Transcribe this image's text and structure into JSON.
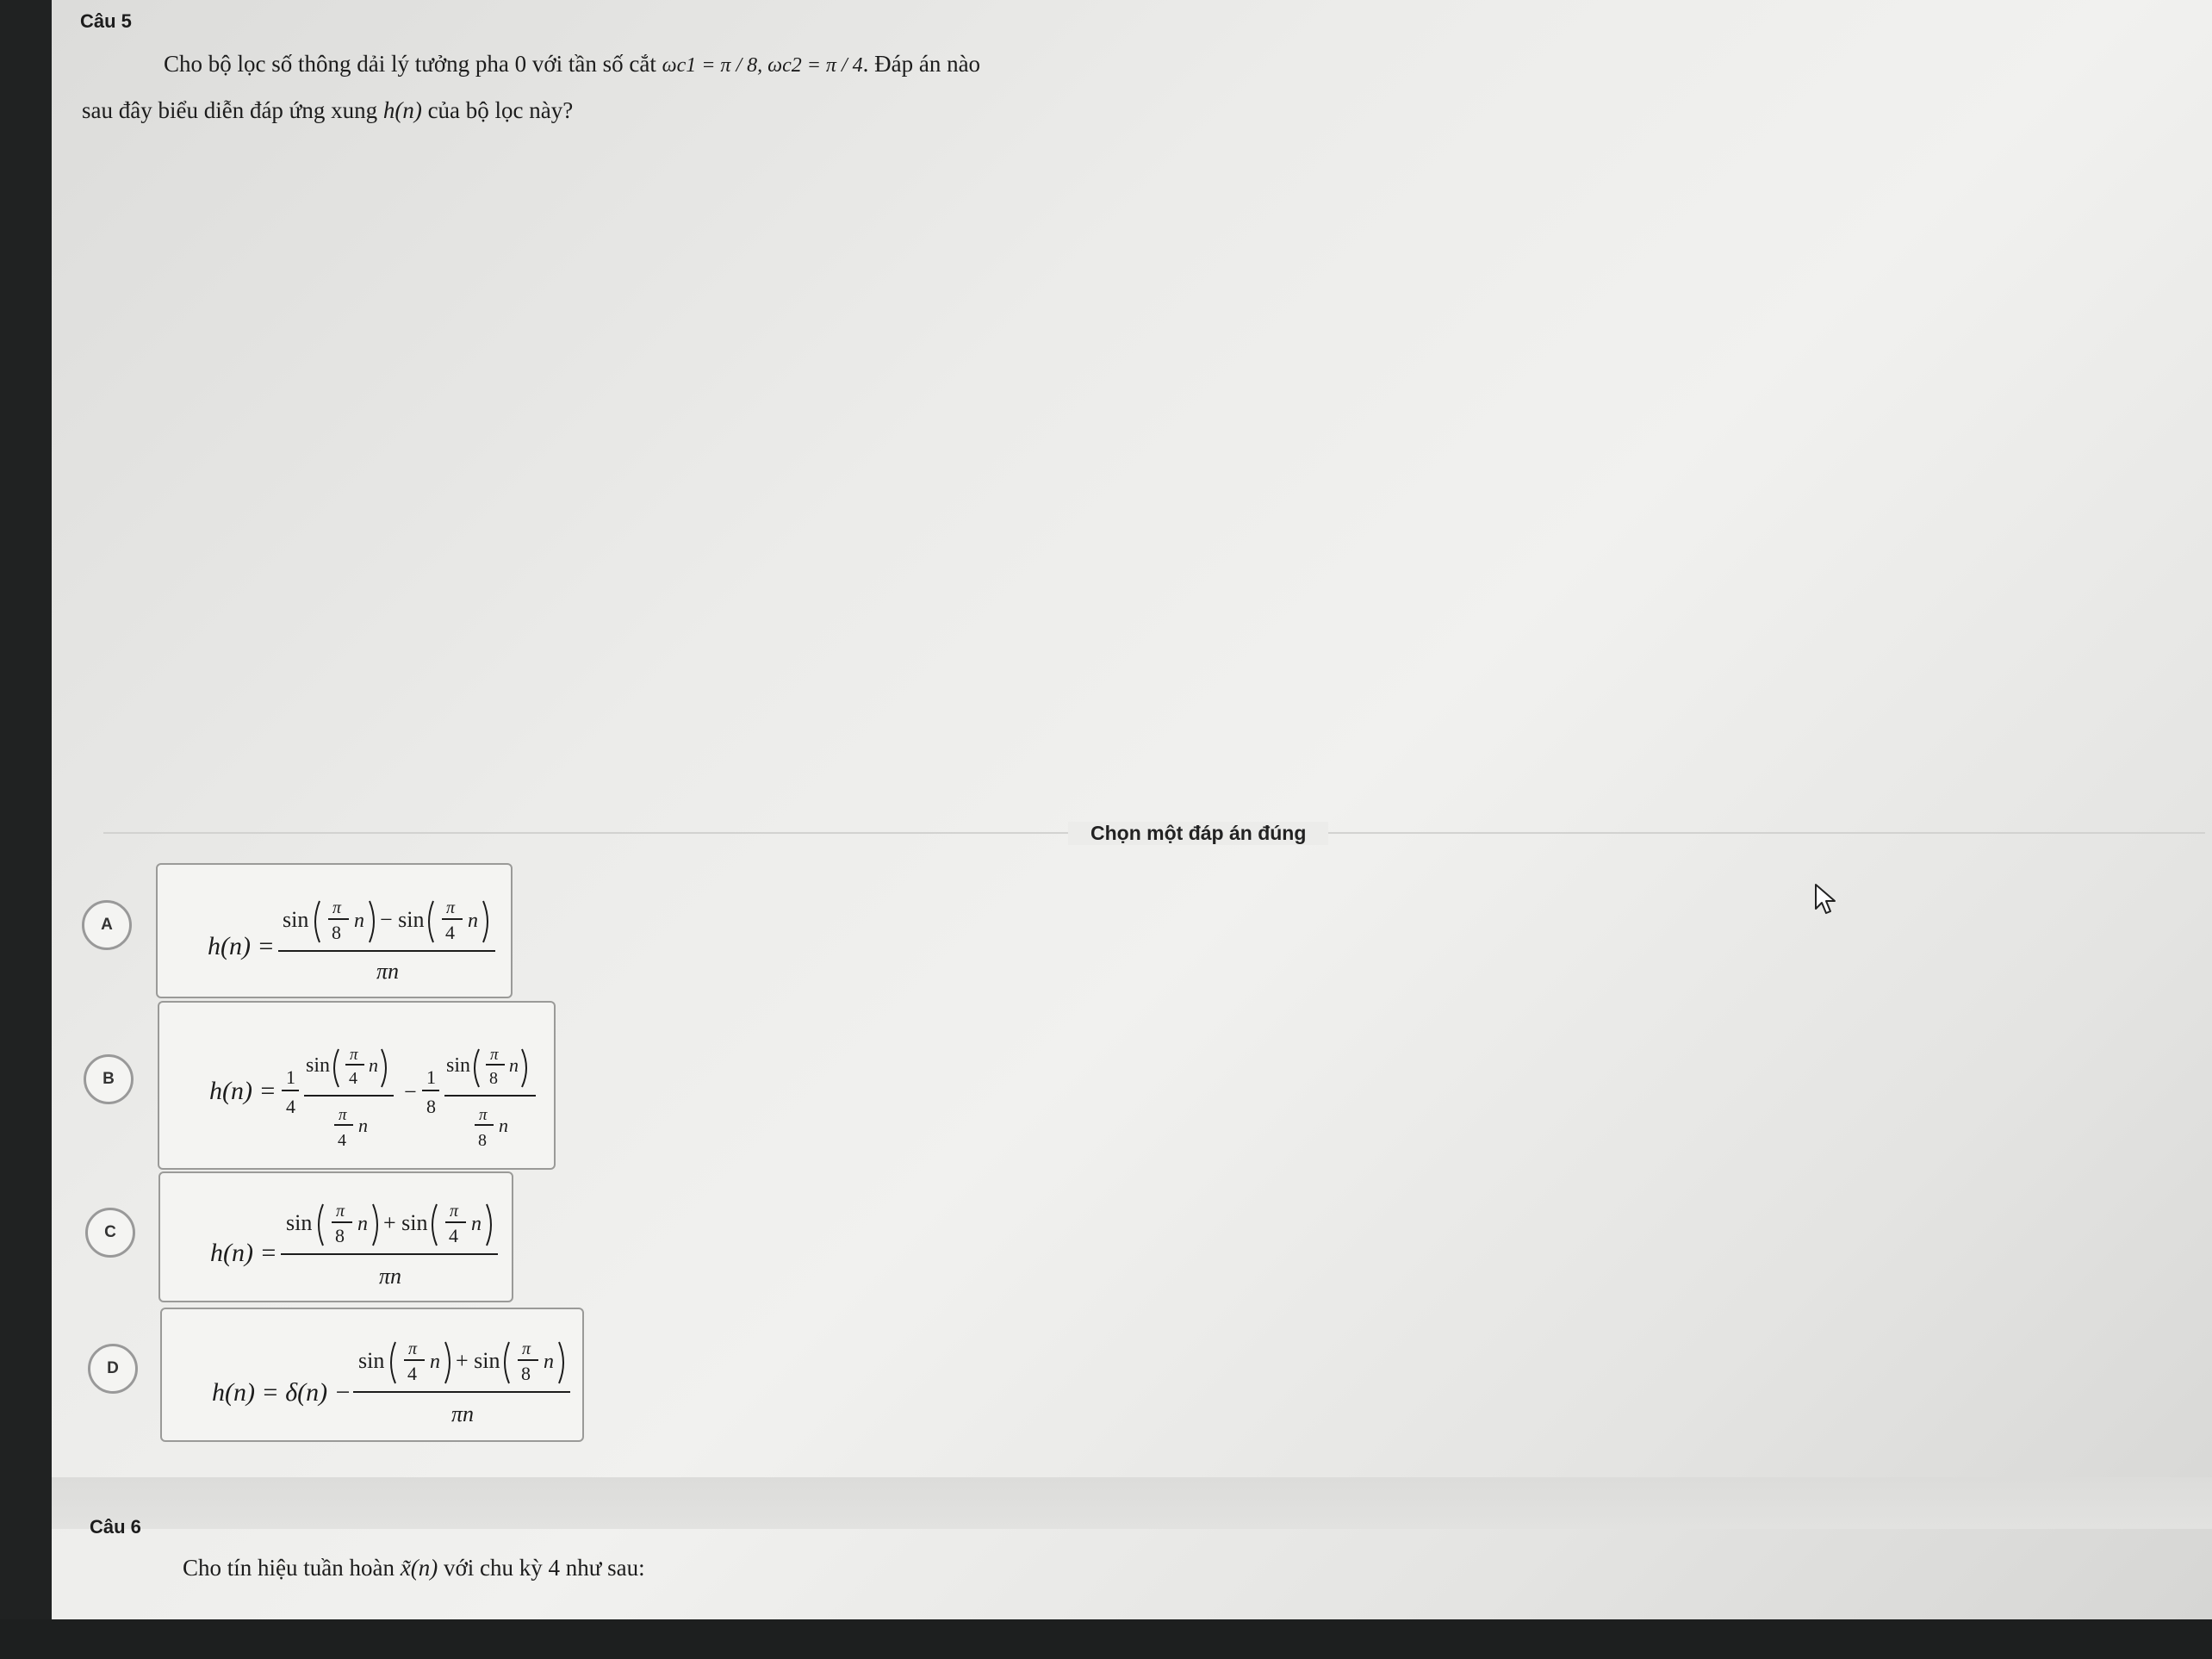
{
  "question5": {
    "title": "Câu 5",
    "line1_text": "Cho bộ lọc số thông dải lý tưởng pha 0 với tần số cắt ",
    "line1_math": "ωc1 = π / 8, ωc2 = π / 4",
    "line1_end": ". Đáp án nào",
    "line2_start": "sau đây biểu diễn đáp ứng xung ",
    "line2_math": "h(n)",
    "line2_end": " của bộ lọc này?"
  },
  "answer_section": {
    "label": "Chọn một đáp án đúng"
  },
  "options": [
    {
      "letter": "A",
      "formula": "h(n) = [sin(π/8 n) − sin(π/4 n)] / (πn)"
    },
    {
      "letter": "B",
      "formula": "h(n) = 1/4 · sin(π/4 n)/(π/4 n) − 1/8 · sin(π/8 n)/(π/8 n)"
    },
    {
      "letter": "C",
      "formula": "h(n) = [sin(π/8 n) + sin(π/4 n)] / (πn)"
    },
    {
      "letter": "D",
      "formula": "h(n) = δ(n) − [sin(π/4 n) + sin(π/8 n)] / (πn)"
    }
  ],
  "question6": {
    "title": "Câu 6",
    "text_start": "Cho tín hiệu tuần hoàn ",
    "text_math": "x̃(n)",
    "text_end": " với chu kỳ 4 như sau:"
  }
}
